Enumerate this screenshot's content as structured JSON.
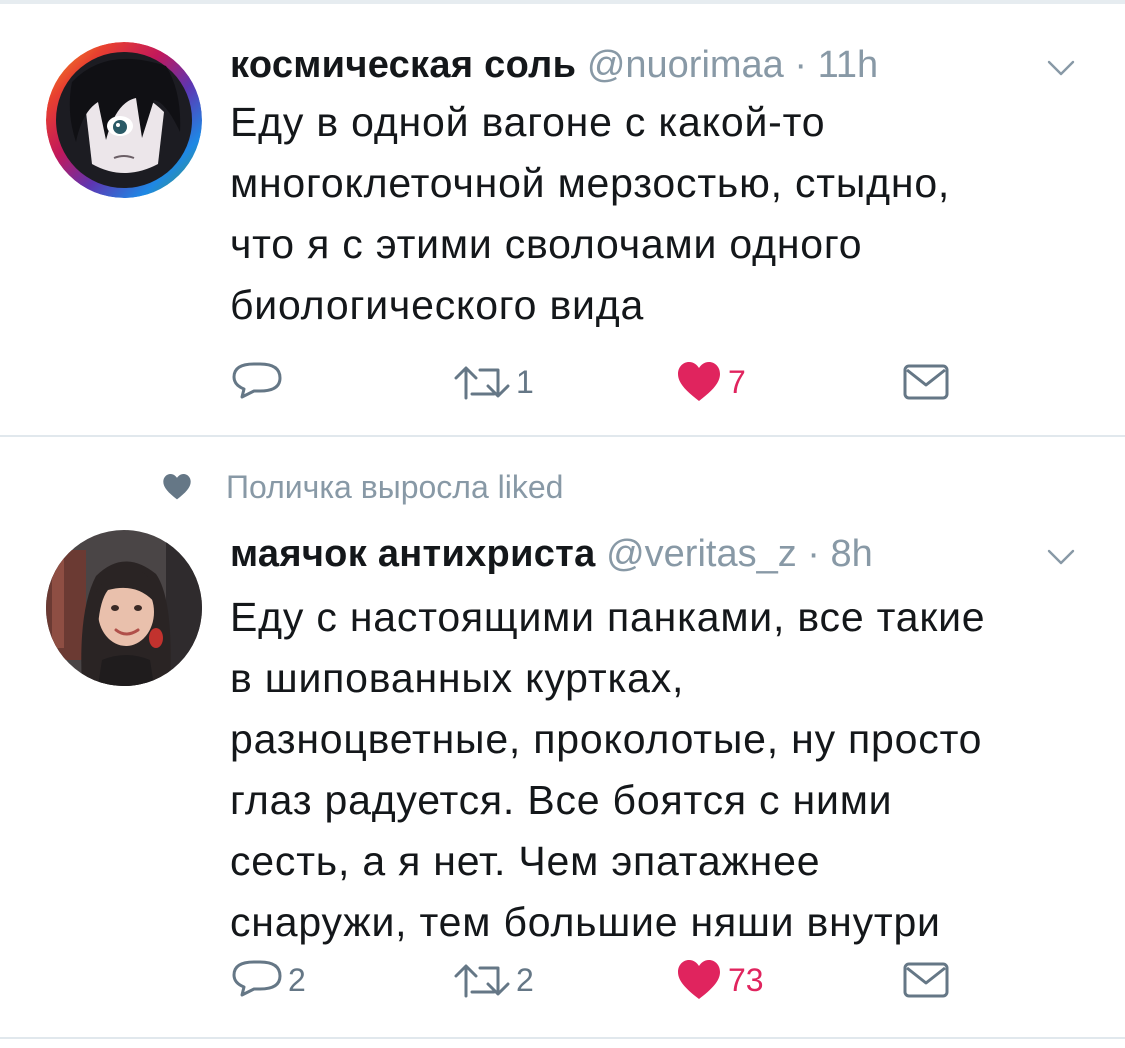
{
  "colors": {
    "text": "#14171a",
    "secondary": "#8899a6",
    "icon": "#657786",
    "like": "#e0245e",
    "divider": "#e1e8ed"
  },
  "tweets": [
    {
      "display_name": "космическая соль",
      "handle": "@nuorimaa",
      "separator": "·",
      "time": "11h",
      "text_lines": [
        "Еду в одной вагоне с какой-то",
        "многоклеточной мерзостью, стыдно,",
        "что я с этими сволочами одного",
        "биологического вида"
      ],
      "reply_count": "",
      "retweet_count": "1",
      "like_count": "7",
      "liked": true,
      "icons": [
        "reply-icon",
        "retweet-icon",
        "heart-icon",
        "envelope-icon"
      ]
    },
    {
      "social_context": "Поличка выросла liked",
      "display_name": "маячок антихриста",
      "handle": "@veritas_z",
      "separator": "·",
      "time": "8h",
      "text_lines": [
        "Еду с настоящими панками, все такие",
        "в шипованных куртках,",
        "разноцветные, проколотые, ну просто",
        "глаз радуется. Все боятся с ними",
        "сесть, а я нет. Чем эпатажнее",
        "снаружи, тем большие няши внутри"
      ],
      "reply_count": "2",
      "retweet_count": "2",
      "like_count": "73",
      "liked": true,
      "icons": [
        "reply-icon",
        "retweet-icon",
        "heart-icon",
        "envelope-icon"
      ]
    }
  ]
}
